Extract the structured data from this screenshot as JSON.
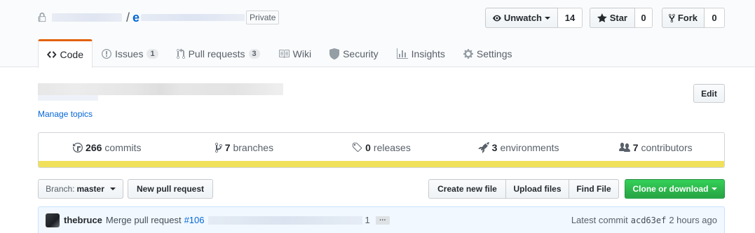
{
  "repo": {
    "owner_visible": "",
    "separator": "/",
    "name_prefix": "e",
    "visibility_label": "Private"
  },
  "actions": {
    "watch": {
      "label": "Unwatch",
      "count": "14"
    },
    "star": {
      "label": "Star",
      "count": "0"
    },
    "fork": {
      "label": "Fork",
      "count": "0"
    }
  },
  "tabs": [
    {
      "label": "Code",
      "count": "",
      "icon": "code-icon"
    },
    {
      "label": "Issues",
      "count": "1",
      "icon": "issue-opened-icon"
    },
    {
      "label": "Pull requests",
      "count": "3",
      "icon": "git-pull-request-icon"
    },
    {
      "label": "Wiki",
      "count": "",
      "icon": "book-icon"
    },
    {
      "label": "Security",
      "count": "",
      "icon": "shield-icon"
    },
    {
      "label": "Insights",
      "count": "",
      "icon": "graph-icon"
    },
    {
      "label": "Settings",
      "count": "",
      "icon": "gear-icon"
    }
  ],
  "about": {
    "manage_topics": "Manage topics",
    "edit_label": "Edit"
  },
  "summary": {
    "commits": {
      "count": "266",
      "label": "commits"
    },
    "branches": {
      "count": "7",
      "label": "branches"
    },
    "releases": {
      "count": "0",
      "label": "releases"
    },
    "environments": {
      "count": "3",
      "label": "environments"
    },
    "contributors": {
      "count": "7",
      "label": "contributors"
    },
    "language_color": "#f1e05a"
  },
  "toolbar": {
    "branch_prefix": "Branch:",
    "branch_name": "master",
    "new_pull_request": "New pull request",
    "create_new_file": "Create new file",
    "upload_files": "Upload files",
    "find_file": "Find File",
    "clone_or_download": "Clone or download"
  },
  "latest_commit": {
    "author": "thebruce",
    "message": "Merge pull request",
    "pr_number": "#106",
    "tail": "1",
    "ellipsis": "…",
    "latest_label": "Latest commit",
    "sha": "acd63ef",
    "time": "2 hours ago"
  },
  "colors": {
    "link": "#0366d6",
    "selected_tab_accent": "#e36209",
    "clone_button": "#28a745",
    "commit_bar_bg": "#f1f8ff"
  }
}
